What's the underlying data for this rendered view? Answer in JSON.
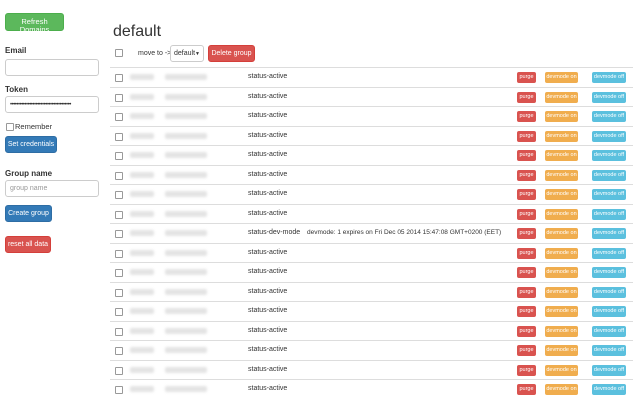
{
  "sidebar": {
    "refresh_label": "Refresh Domains",
    "email_label": "Email",
    "email_value": "",
    "token_label": "Token",
    "token_value": "••••••••••••••••••••••••••••••••••••••",
    "remember_label": "Remember",
    "set_credentials_label": "Set credentials",
    "group_name_label": "Group name",
    "group_name_placeholder": "group name",
    "create_group_label": "Create group",
    "reset_label": "reset all data"
  },
  "main": {
    "title": "default",
    "move_to_label": "move to ->",
    "group_select_value": "default",
    "delete_group_label": "Delete group"
  },
  "row_buttons": {
    "purge": "purge",
    "devmode_on": "devmode on",
    "devmode_off": "devmode off"
  },
  "rows": [
    {
      "status": "status-active",
      "info": ""
    },
    {
      "status": "status-active",
      "info": ""
    },
    {
      "status": "status-active",
      "info": ""
    },
    {
      "status": "status-active",
      "info": ""
    },
    {
      "status": "status-active",
      "info": ""
    },
    {
      "status": "status-active",
      "info": ""
    },
    {
      "status": "status-active",
      "info": ""
    },
    {
      "status": "status-active",
      "info": ""
    },
    {
      "status": "status-dev-mode",
      "info": "devmode: 1 expires on Fri Dec 05 2014 15:47:08 GMT+0200 (EET)"
    },
    {
      "status": "status-active",
      "info": ""
    },
    {
      "status": "status-active",
      "info": ""
    },
    {
      "status": "status-active",
      "info": ""
    },
    {
      "status": "status-active",
      "info": ""
    },
    {
      "status": "status-active",
      "info": ""
    },
    {
      "status": "status-active",
      "info": ""
    },
    {
      "status": "status-active",
      "info": ""
    },
    {
      "status": "status-active",
      "info": ""
    }
  ],
  "colors": {
    "success": "#5cb85c",
    "primary": "#337ab7",
    "danger": "#d9534f",
    "warning": "#f0ad4e",
    "info": "#5bc0de"
  }
}
